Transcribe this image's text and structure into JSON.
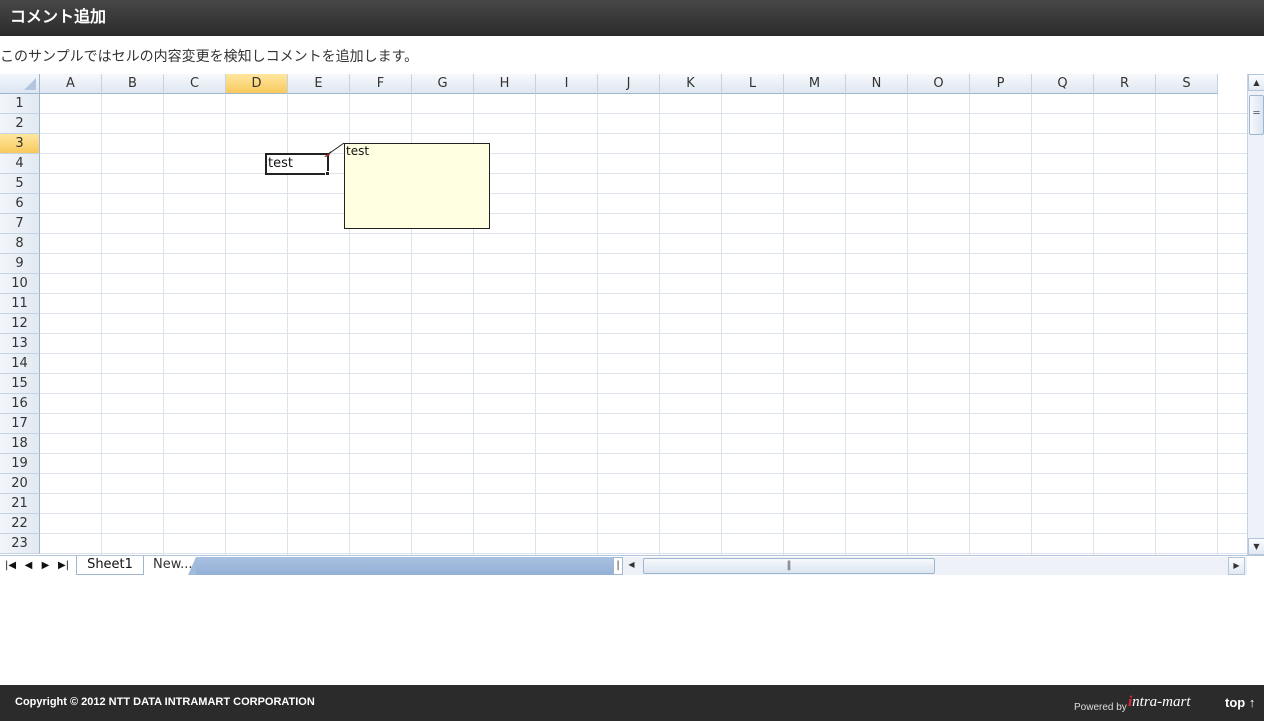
{
  "header": {
    "title": "コメント追加"
  },
  "description": "このサンプルではセルの内容変更を検知しコメントを追加します。",
  "sheet": {
    "columns": [
      "A",
      "B",
      "C",
      "D",
      "E",
      "F",
      "G",
      "H",
      "I",
      "J",
      "K",
      "L",
      "M",
      "N",
      "O",
      "P",
      "Q",
      "R",
      "S"
    ],
    "rows": [
      "1",
      "2",
      "3",
      "4",
      "5",
      "6",
      "7",
      "8",
      "9",
      "10",
      "11",
      "12",
      "13",
      "14",
      "15",
      "16",
      "17",
      "18",
      "19",
      "20",
      "21",
      "22",
      "23"
    ],
    "selected_column": "D",
    "selected_row": "3",
    "active_cell_value": "test",
    "comment_text": "test"
  },
  "tabs": {
    "sheet1": "Sheet1",
    "new": "New..."
  },
  "icons": {
    "first": "first-sheet-icon",
    "prev": "prev-sheet-icon",
    "next": "next-sheet-icon",
    "last": "last-sheet-icon",
    "scroll_up": "scroll-up-icon",
    "scroll_down": "scroll-down-icon",
    "scroll_left": "scroll-left-icon",
    "scroll_right": "scroll-right-icon"
  },
  "colors": {
    "selected_header": "#f8c95c",
    "comment_bg": "#ffffe1",
    "tab_strip": "#93b0d7"
  },
  "footer": {
    "copyright": "Copyright © 2012 NTT DATA INTRAMART CORPORATION",
    "powered_by": "Powered by",
    "brand_i": "i",
    "brand_rest": "ntra-mart",
    "top_link": "top ↑"
  }
}
